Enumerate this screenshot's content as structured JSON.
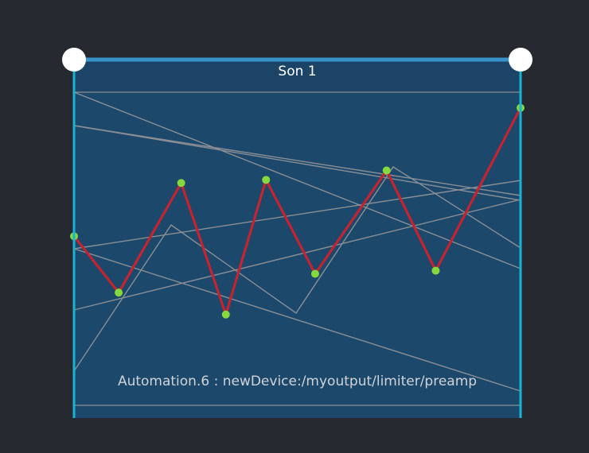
{
  "slot": {
    "title": "Son 1"
  },
  "process": {
    "label": "Automation.6 : newDevice:/myoutput/limiter/preamp"
  },
  "colors": {
    "background": "#262a30",
    "slot_fill": "#1c486b",
    "slot_header": "#1b4467",
    "interval_bar": "#3892cc",
    "interval_edge": "#18b4d4",
    "curve": "#c3242f",
    "point": "#86d93c",
    "guide": "#8a8f95",
    "handle": "#ffffff"
  },
  "icons": {
    "start_handle": "start-handle-icon",
    "end_handle": "end-handle-icon"
  },
  "chart_data": {
    "type": "line",
    "x": [
      0,
      0.1,
      0.24,
      0.34,
      0.43,
      0.54,
      0.7,
      0.81,
      1.0
    ],
    "y": [
      0.54,
      0.36,
      0.71,
      0.29,
      0.72,
      0.42,
      0.75,
      0.43,
      0.95
    ],
    "xlim": [
      0,
      1
    ],
    "ylim": [
      0,
      1
    ]
  }
}
